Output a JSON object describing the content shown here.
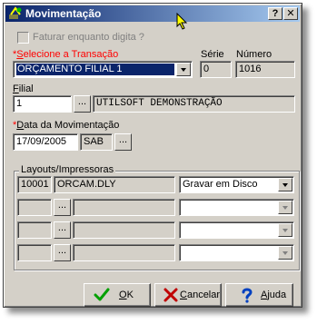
{
  "window": {
    "title": "Movimentação",
    "help_label": "?",
    "close_label": "✕"
  },
  "form": {
    "faturar_label": "Faturar enquanto digita ?",
    "transacao": {
      "label_prefix": "*",
      "label_hotkey": "S",
      "label_rest": "elecione a Transação",
      "value": "ORÇAMENTO FILIAL 1"
    },
    "serie": {
      "label": "Série",
      "value": "0"
    },
    "numero": {
      "label": "Número",
      "value": "1016"
    },
    "filial": {
      "label_hotkey": "F",
      "label_rest": "ilial",
      "code": "1",
      "name": "UTILSOFT DEMONSTRAÇÃO",
      "lookup_label": "..."
    },
    "data": {
      "label_prefix": "*",
      "label_hotkey": "D",
      "label_rest": "ata da Movimentação",
      "value": "17/09/2005",
      "weekday": "SAB",
      "picker_label": "..."
    },
    "layouts": {
      "label": "Layouts/Impressoras",
      "rows": [
        {
          "code": "10001",
          "file": "ORCAM.DLY",
          "action": "Gravar em Disco"
        },
        {
          "code": "",
          "file": "",
          "action": ""
        },
        {
          "code": "",
          "file": "",
          "action": ""
        },
        {
          "code": "",
          "file": "",
          "action": ""
        }
      ],
      "lookup_label": "..."
    }
  },
  "buttons": {
    "ok": {
      "hotkey": "O",
      "rest": "K"
    },
    "cancel": {
      "hotkey": "C",
      "rest": "ancelar"
    },
    "help": {
      "hotkey": "A",
      "rest": "juda"
    }
  },
  "colors": {
    "title_start": "#0a246a",
    "title_end": "#a6caf0",
    "face": "#d4d0c8",
    "required_label": "#ff0000",
    "selection": "#0a246a"
  },
  "icons": {
    "app": "app-icon",
    "ok": "check-icon",
    "cancel": "x-icon",
    "help": "question-icon",
    "pointer": "mouse-cursor-icon"
  }
}
